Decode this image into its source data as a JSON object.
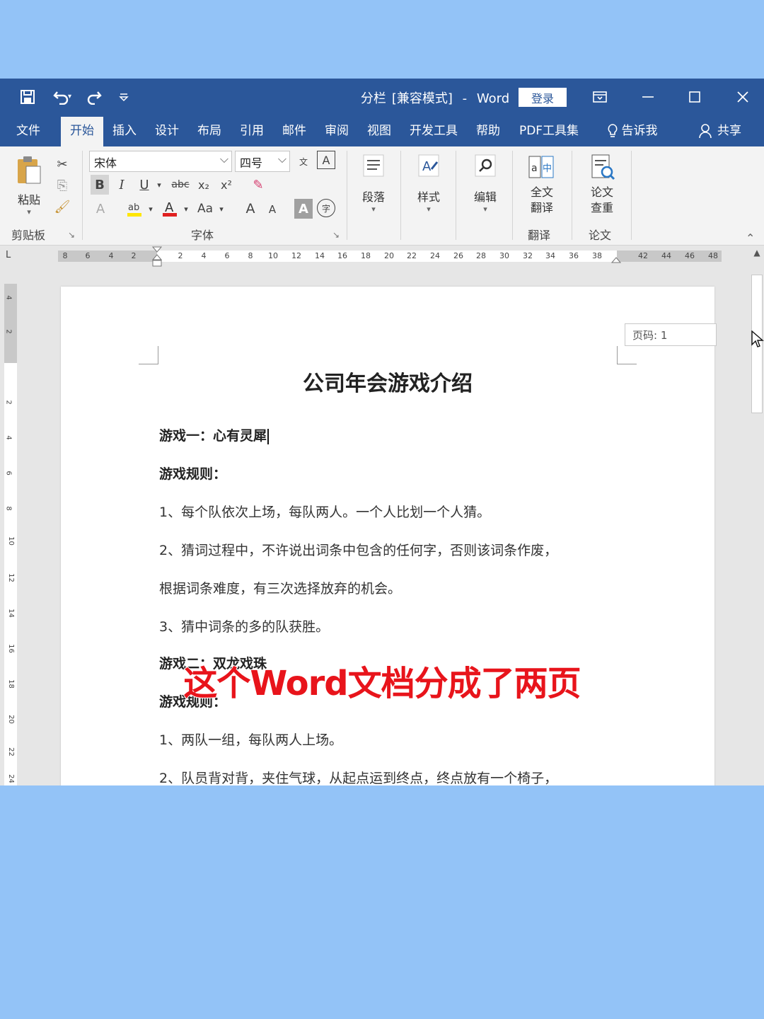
{
  "titlebar": {
    "doc_name": "分栏",
    "mode": "[兼容模式]",
    "separator": "-",
    "app_name": "Word",
    "login_label": "登录",
    "quick_access": {
      "save_icon": "save-icon",
      "undo_icon": "undo-icon",
      "redo_icon": "redo-icon",
      "customize_icon": "customize-icon"
    }
  },
  "tabs": [
    {
      "label": "文件"
    },
    {
      "label": "开始"
    },
    {
      "label": "插入"
    },
    {
      "label": "设计"
    },
    {
      "label": "布局"
    },
    {
      "label": "引用"
    },
    {
      "label": "邮件"
    },
    {
      "label": "审阅"
    },
    {
      "label": "视图"
    },
    {
      "label": "开发工具"
    },
    {
      "label": "帮助"
    },
    {
      "label": "PDF工具集"
    },
    {
      "label": "告诉我"
    },
    {
      "label": "共享"
    }
  ],
  "active_tab": "开始",
  "ribbon": {
    "clipboard": {
      "paste_label": "粘贴",
      "group_label": "剪贴板"
    },
    "font": {
      "font_name": "宋体",
      "font_size": "四号",
      "group_label": "字体",
      "bold": "B",
      "italic": "I",
      "underline": "U",
      "strike": "abc",
      "subscript": "x₂",
      "superscript": "x²",
      "change_case": "Aa",
      "grow": "A",
      "shrink": "A",
      "highlight_color": "#ffe600",
      "font_color": "#e02020"
    },
    "paragraph": {
      "label": "段落"
    },
    "styles": {
      "label": "样式"
    },
    "editing": {
      "label": "编辑"
    },
    "translate": {
      "line1": "全文",
      "line2": "翻译",
      "group_label": "翻译"
    },
    "paper": {
      "line1": "论文",
      "line2": "查重",
      "group_label": "论文"
    }
  },
  "ruler": {
    "ticks": [
      "8",
      "6",
      "4",
      "2",
      "2",
      "4",
      "6",
      "8",
      "10",
      "12",
      "14",
      "16",
      "18",
      "20",
      "22",
      "24",
      "26",
      "28",
      "30",
      "32",
      "34",
      "36",
      "38",
      "42",
      "44",
      "46",
      "48"
    ],
    "vticks": [
      "4",
      "2",
      "2",
      "4",
      "6",
      "8",
      "10",
      "12",
      "14",
      "16",
      "18",
      "20",
      "22",
      "24"
    ]
  },
  "page": {
    "page_number_label": "页码: 1",
    "title": "公司年会游戏介绍",
    "paragraphs": [
      {
        "text": "游戏一：心有灵犀",
        "bold": true
      },
      {
        "text": "游戏规则：",
        "bold": true
      },
      {
        "text": "1、每个队依次上场，每队两人。一个人比划一个人猜。",
        "bold": false
      },
      {
        "text": "2、猜词过程中，不许说出词条中包含的任何字，否则该词条作废，",
        "bold": false
      },
      {
        "text": "根据词条难度，有三次选择放弃的机会。",
        "bold": false
      },
      {
        "text": "3、猜中词条的多的队获胜。",
        "bold": false
      },
      {
        "text": "游戏二：双龙戏珠",
        "bold": true
      },
      {
        "text": "游戏规则：",
        "bold": true
      },
      {
        "text": "1、两队一组，每队两人上场。",
        "bold": false
      },
      {
        "text": "2、队员背对背，夹住气球，从起点运到终点，终点放有一个椅子，",
        "bold": false
      }
    ]
  },
  "overlay": {
    "subtitle": "这个Word文档分成了两页"
  },
  "colors": {
    "word_blue": "#2b579a",
    "background": "#93c3f7",
    "subtitle_red": "#e8141b"
  }
}
